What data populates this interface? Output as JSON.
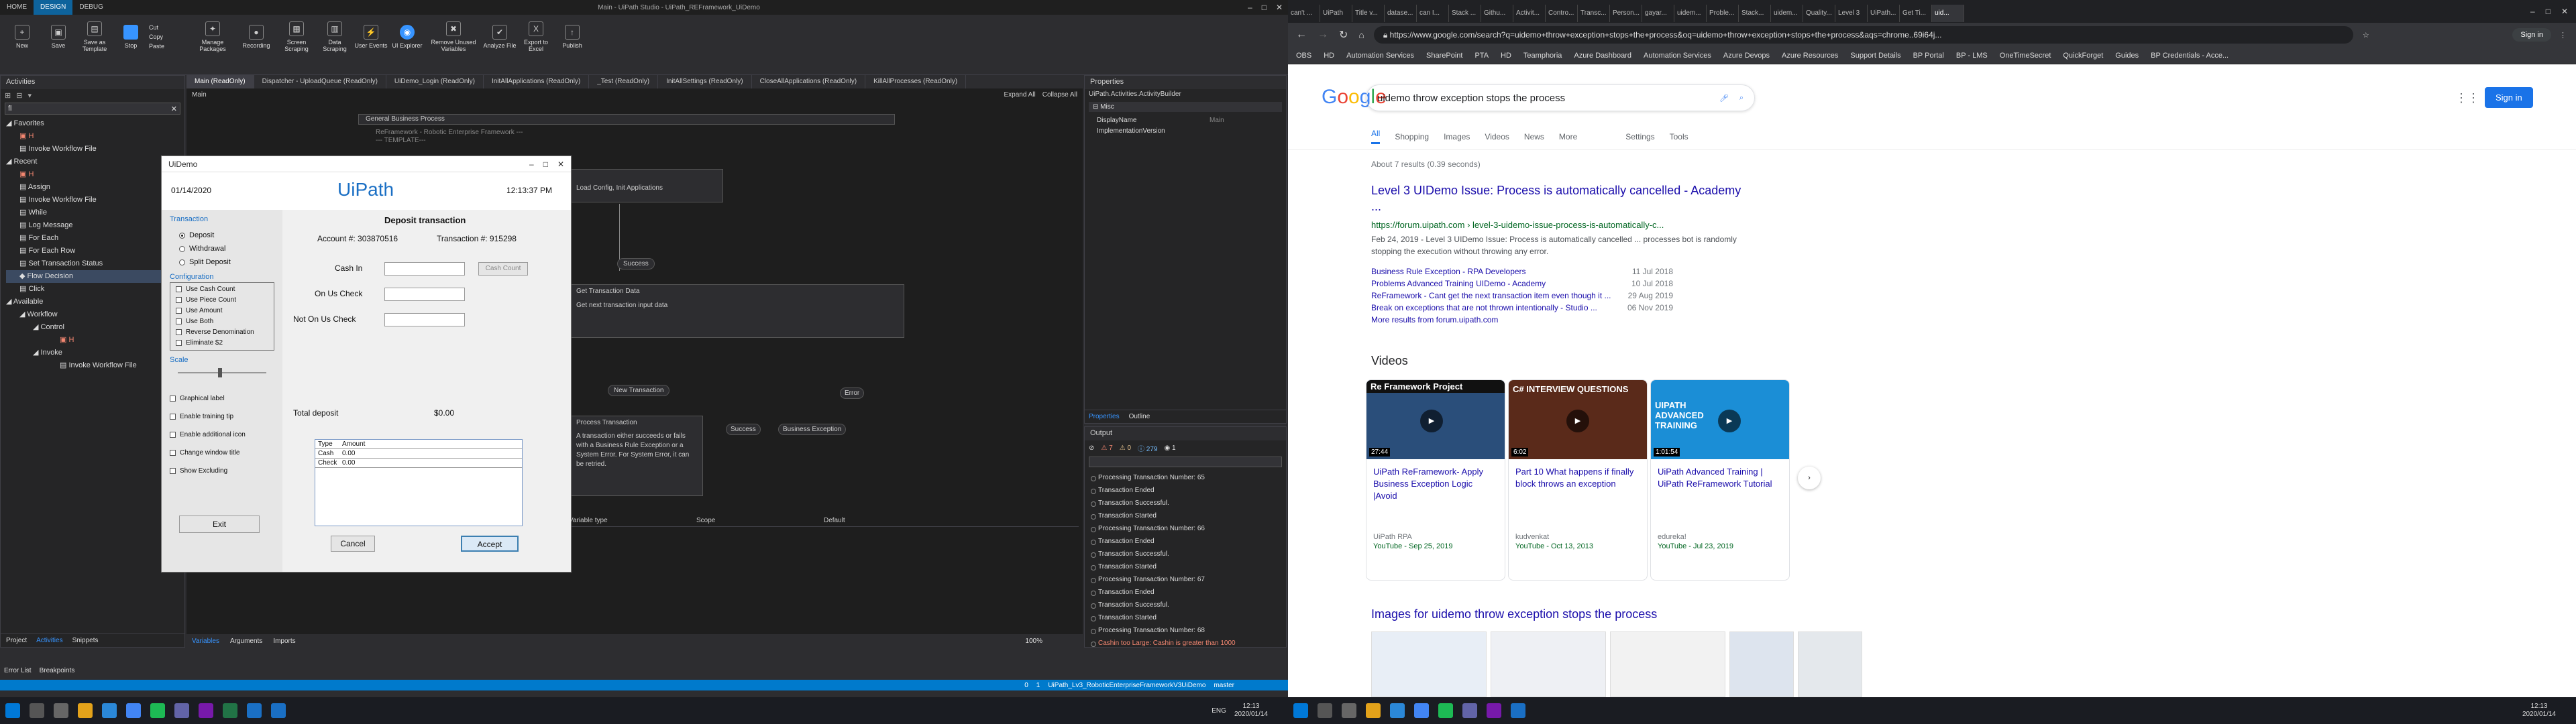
{
  "left": {
    "title_bar": {
      "tabs": [
        "HOME",
        "DESIGN",
        "DEBUG"
      ],
      "window_title": "Main - UiPath Studio - UiPath_REFramework_UiDemo"
    },
    "ribbon": {
      "buttons": [
        "New",
        "Save",
        "Save as Template",
        "Stop",
        "Manage Packages",
        "Recording",
        "Screen Scraping",
        "Data Scraping",
        "User Events",
        "UI Explorer",
        "Remove Unused Variables",
        "Analyze File",
        "Export to Excel",
        "Publish"
      ],
      "clipboard": [
        "Cut",
        "Copy",
        "Paste"
      ]
    },
    "activities_panel": {
      "header": "Activities",
      "search_value": "fl",
      "favorites_label": "Favorites",
      "favorites": [
        "H",
        "Invoke Workflow File"
      ],
      "recent_label": "Recent",
      "recent": [
        "H",
        "Assign",
        "Invoke Workflow File",
        "While",
        "Log Message",
        "For Each",
        "For Each Row",
        "Set Transaction Status",
        "Flow Decision",
        "Click"
      ],
      "available_label": "Available",
      "available": [
        "Workflow",
        "Control",
        "H",
        "Invoke",
        "Invoke Workflow File"
      ],
      "bottom_tabs": [
        "Project",
        "Activities",
        "Snippets"
      ]
    },
    "doc_tabs": [
      "Main (ReadOnly)",
      "Dispatcher - UploadQueue (ReadOnly)",
      "UiDemo_Login (ReadOnly)",
      "InitAllApplications (ReadOnly)",
      "_Test (ReadOnly)",
      "InitAllSettings (ReadOnly)",
      "CloseAllApplications (ReadOnly)",
      "KillAllProcesses (ReadOnly)"
    ],
    "designer": {
      "breadcrumb": "Main",
      "expand_all": "Expand All",
      "collapse_all": "Collapse All",
      "flow_title": "General Business Process",
      "flow_subtitle": "ReFramework - Robotic Enterprise Framework ---",
      "template_note": "--- TEMPLATE---",
      "init_text": "Load Config, Init Applications",
      "get_data": "Get Transaction Data",
      "get_data_desc": "Get next transaction input data",
      "success1": "Success",
      "new_transaction": "New Transaction",
      "error": "Error",
      "success2": "Success",
      "business_exception": "Business Exception",
      "process_transaction": "Process Transaction",
      "process_desc": "A transaction either succeeds or fails with a Business Rule Exception or a System Error. For System Error, it can be retried.",
      "var_headers": [
        "Variable type",
        "Scope",
        "Default"
      ],
      "bottom_tabs": [
        "Variables",
        "Arguments",
        "Imports"
      ],
      "zoom": "100%"
    },
    "properties": {
      "header": "Properties",
      "type": "UiPath.Activities.ActivityBuilder",
      "misc": "Misc",
      "rows": [
        [
          "DisplayName",
          "Main"
        ],
        [
          "ImplementationVersion",
          ""
        ]
      ],
      "tabs": [
        "Properties",
        "Outline"
      ]
    },
    "output": {
      "header": "Output",
      "counts": [
        "7",
        "0",
        "279",
        "1"
      ],
      "lines": [
        "Processing Transaction Number: 65",
        "Transaction Ended",
        "Transaction Successful.",
        "Transaction Started",
        "Processing Transaction Number: 66",
        "Transaction Ended",
        "Transaction Successful.",
        "Transaction Started",
        "Processing Transaction Number: 67",
        "Transaction Ended",
        "Transaction Successful.",
        "Transaction Started",
        "Processing Transaction Number: 68",
        "Cashin too Large: Cashin is greater than 1000"
      ]
    },
    "error_tabs": [
      "Error List",
      "Breakpoints"
    ],
    "status_bar": {
      "left": "",
      "right": [
        "0",
        "1",
        "UiPath_Lv3_RoboticEnterpriseFrameworkV3UiDemo",
        "master"
      ]
    },
    "uidemo": {
      "window_title": "UiDemo",
      "date": "01/14/2020",
      "logo": "UiPath",
      "time": "12:13:37 PM",
      "transaction_label": "Transaction",
      "transaction_options": [
        "Deposit",
        "Withdrawal",
        "Split Deposit"
      ],
      "configuration_label": "Configuration",
      "config_options": [
        "Use Cash Count",
        "Use Piece Count",
        "Use Amount",
        "Use Both",
        "Reverse Denomination",
        "Eliminate $2"
      ],
      "scale_label": "Scale",
      "extra_options": [
        "Graphical label",
        "Enable training tip",
        "Enable additional icon",
        "Change window title",
        "Show Excluding"
      ],
      "exit": "Exit",
      "panel_title": "Deposit transaction",
      "account": "Account #: 303870516",
      "transaction_no": "Transaction #: 915298",
      "fields": [
        "Cash In",
        "On Us Check",
        "Not On Us Check"
      ],
      "cash_count_btn": "Cash Count",
      "total_label": "Total deposit",
      "total_value": "$0.00",
      "table_headers": [
        "Type",
        "Amount"
      ],
      "table_rows": [
        [
          "Cash",
          "0.00"
        ],
        [
          "Check",
          "0.00"
        ]
      ],
      "cancel": "Cancel",
      "accept": "Accept"
    },
    "taskbar": {
      "clock_time": "12:13",
      "clock_date": "2020/01/14",
      "lang": "ENG"
    }
  },
  "right": {
    "tabs": [
      "can't ...",
      "UiPath",
      "Title v...",
      "datase...",
      "can I...",
      "Stack ...",
      "Githu...",
      "Activit...",
      "Contro...",
      "Transc...",
      "Person...",
      "gayar...",
      "uidem...",
      "Proble...",
      "Stack...",
      "uidem...",
      "Quality...",
      "Level 3",
      "UiPath...",
      "Get Ti...",
      "uid..."
    ],
    "url": "https://www.google.com/search?q=uidemo+throw+exception+stops+the+process&oq=uidemo+throw+exception+stops+the+process&aqs=chrome..69i64j...",
    "sign_in": "Sign in",
    "bookmarks": [
      "OBS",
      "HD",
      "Automation Services",
      "SharePoint",
      "PTA",
      "HD",
      "Teamphoria",
      "Azure Dashboard",
      "Automation Services",
      "Azure Devops",
      "Azure Resources",
      "Support Details",
      "BP Portal",
      "BP - LMS",
      "OneTimeSecret",
      "QuickForget",
      "Guides",
      "BP Credentials - Acce..."
    ],
    "google": {
      "logo": "Google",
      "query": "uidemo throw exception stops the process",
      "nav": [
        "All",
        "Shopping",
        "Images",
        "Videos",
        "News",
        "More",
        "Settings",
        "Tools"
      ],
      "stats": "About 7 results (0.39 seconds)",
      "result_title": "Level 3 UIDemo Issue: Process is automatically cancelled - Academy ...",
      "result_url": "https://forum.uipath.com › level-3-uidemo-issue-process-is-automatically-c...",
      "result_snippet": "Feb 24, 2019 - Level 3 UIDemo Issue: Process is automatically cancelled ... processes bot is randomly stopping the execution without throwing any error.",
      "sublinks": [
        [
          "Business Rule Exception - RPA Developers",
          "11 Jul 2018"
        ],
        [
          "Problems Advanced Training UIDemo - Academy",
          "10 Jul 2018"
        ],
        [
          "ReFramework - Cant get the next transaction item even though it ...",
          "29 Aug 2019"
        ],
        [
          "Break on exceptions that are not thrown intentionally - Studio ...",
          "06 Nov 2019"
        ]
      ],
      "more_results": "More results from forum.uipath.com",
      "videos_header": "Videos",
      "videos": [
        {
          "thumb_text": "Re Framework Project",
          "duration": "27:44",
          "title": "UiPath ReFramework- Apply Business Exception Logic |Avoid",
          "channel": "UiPath RPA",
          "source": "YouTube - Sep 25, 2019"
        },
        {
          "thumb_text": "C# INTERVIEW QUESTIONS",
          "duration": "6:02",
          "title": "Part 10 What happens if finally block throws an exception",
          "channel": "kudvenkat",
          "source": "YouTube - Oct 13, 2013"
        },
        {
          "thumb_text": "UIPATH ADVANCED TRAINING",
          "duration": "1:01:54",
          "title": "UiPath Advanced Training | UiPath ReFramework Tutorial",
          "channel": "edureka!",
          "source": "YouTube - Jul 23, 2019"
        }
      ],
      "images_header": "Images for uidemo throw exception stops the process"
    },
    "taskbar": {
      "clock_time": "12:13",
      "clock_date": "2020/01/14"
    }
  },
  "colors": {
    "accent": "#0e639c",
    "status_blue": "#007acc",
    "google_link": "#1a0dab",
    "google_green": "#006621",
    "uipath_blue": "#1a6fc4",
    "error_red": "#f48771"
  }
}
